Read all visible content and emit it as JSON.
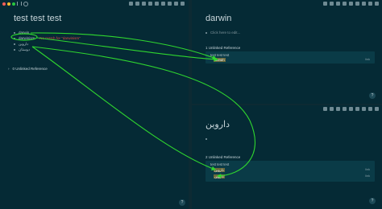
{
  "colors": {
    "accent_green": "#2fd62f",
    "error_red": "#dd4444"
  },
  "left_page": {
    "title": "test test test",
    "items": [
      "darwin",
      "darwinism",
      "داروین",
      "دوستان"
    ],
    "no_match_hint": "No match for \"darwinism\"",
    "unlinked_refs": "0 Unlinked Reference",
    "help_button": "?"
  },
  "top_right_page": {
    "title": "darwin",
    "add_placeholder": "Click here to edit...",
    "refs_header": "1 Unlinked Reference",
    "ref_page": "test test test",
    "ref_item": "darwin",
    "link_label": "link",
    "help_button": "?"
  },
  "bottom_right_page": {
    "title": "داروین",
    "refs_header": "2 Unlinked Reference",
    "ref_page": "test test test",
    "ref_items": [
      "داروین",
      "داروین"
    ],
    "link_label": "link",
    "help_button": "?"
  }
}
